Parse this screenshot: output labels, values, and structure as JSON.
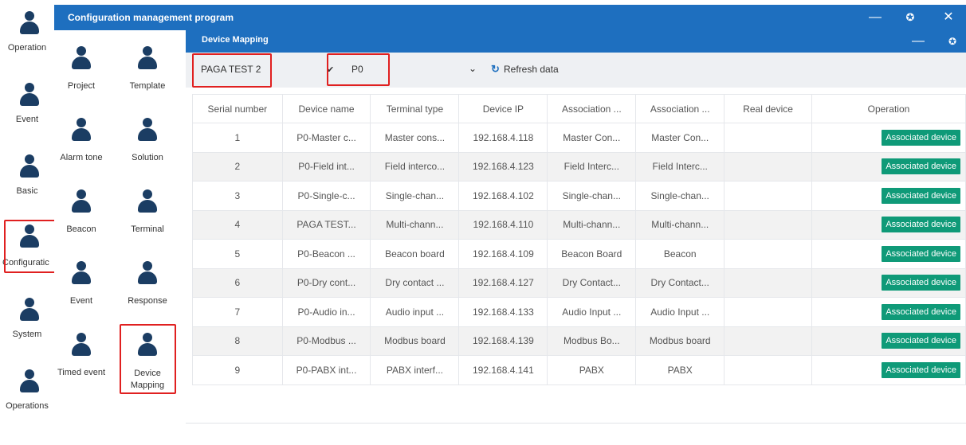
{
  "app": {
    "title": "Configuration management program"
  },
  "rail": {
    "items": [
      {
        "label": "Operation"
      },
      {
        "label": "Event"
      },
      {
        "label": "Basic"
      },
      {
        "label": "Configuratic"
      },
      {
        "label": "System"
      },
      {
        "label": "Operations"
      }
    ]
  },
  "panel2": {
    "items": [
      {
        "label": "Project"
      },
      {
        "label": "Template"
      },
      {
        "label": "Alarm tone"
      },
      {
        "label": "Solution"
      },
      {
        "label": "Beacon"
      },
      {
        "label": "Terminal"
      },
      {
        "label": "Event"
      },
      {
        "label": "Response"
      },
      {
        "label": "Timed event"
      },
      {
        "label": "Device Mapping"
      }
    ]
  },
  "subwindow": {
    "title": "Device Mapping"
  },
  "toolbar": {
    "project_value": "PAGA TEST 2",
    "check_mark": "✔",
    "zone_value": "P0",
    "refresh_label": "Refresh data"
  },
  "table": {
    "headers": [
      "Serial number",
      "Device name",
      "Terminal type",
      "Device IP",
      "Association ...",
      "Association ...",
      "Real device",
      "Operation"
    ],
    "rows": [
      {
        "serial": "1",
        "name": "P0-Master c...",
        "type": "Master cons...",
        "ip": "192.168.4.118",
        "assoc1": "Master Con...",
        "assoc2": "Master Con...",
        "real": "",
        "op": "Associated device"
      },
      {
        "serial": "2",
        "name": "P0-Field int...",
        "type": "Field interco...",
        "ip": "192.168.4.123",
        "assoc1": "Field Interc...",
        "assoc2": "Field Interc...",
        "real": "",
        "op": "Associated device"
      },
      {
        "serial": "3",
        "name": "P0-Single-c...",
        "type": "Single-chan...",
        "ip": "192.168.4.102",
        "assoc1": "Single-chan...",
        "assoc2": "Single-chan...",
        "real": "",
        "op": "Associated device"
      },
      {
        "serial": "4",
        "name": "PAGA TEST...",
        "type": "Multi-chann...",
        "ip": "192.168.4.110",
        "assoc1": "Multi-chann...",
        "assoc2": "Multi-chann...",
        "real": "",
        "op": "Associated device"
      },
      {
        "serial": "5",
        "name": "P0-Beacon ...",
        "type": "Beacon board",
        "ip": "192.168.4.109",
        "assoc1": "Beacon Board",
        "assoc2": "Beacon",
        "real": "",
        "op": "Associated device"
      },
      {
        "serial": "6",
        "name": "P0-Dry cont...",
        "type": "Dry contact ...",
        "ip": "192.168.4.127",
        "assoc1": "Dry Contact...",
        "assoc2": "Dry Contact...",
        "real": "",
        "op": "Associated device"
      },
      {
        "serial": "7",
        "name": "P0-Audio in...",
        "type": "Audio input ...",
        "ip": "192.168.4.133",
        "assoc1": "Audio Input ...",
        "assoc2": "Audio Input ...",
        "real": "",
        "op": "Associated device"
      },
      {
        "serial": "8",
        "name": "P0-Modbus ...",
        "type": "Modbus board",
        "ip": "192.168.4.139",
        "assoc1": "Modbus Bo...",
        "assoc2": "Modbus board",
        "real": "",
        "op": "Associated device"
      },
      {
        "serial": "9",
        "name": "P0-PABX int...",
        "type": "PABX interf...",
        "ip": "192.168.4.141",
        "assoc1": "PABX",
        "assoc2": "PABX",
        "real": "",
        "op": "Associated device"
      }
    ]
  },
  "colors": {
    "titlebar": "#1e6fbf",
    "icon": "#1b3d63",
    "action": "#0f9a78",
    "highlight": "#e02020"
  },
  "icons": {
    "window_minimize": "minimize-icon",
    "window_restore": "restore-icon",
    "window_close": "close-icon",
    "refresh": "refresh-icon",
    "dropdown": "chevron-down-icon",
    "user": "person-icon"
  }
}
